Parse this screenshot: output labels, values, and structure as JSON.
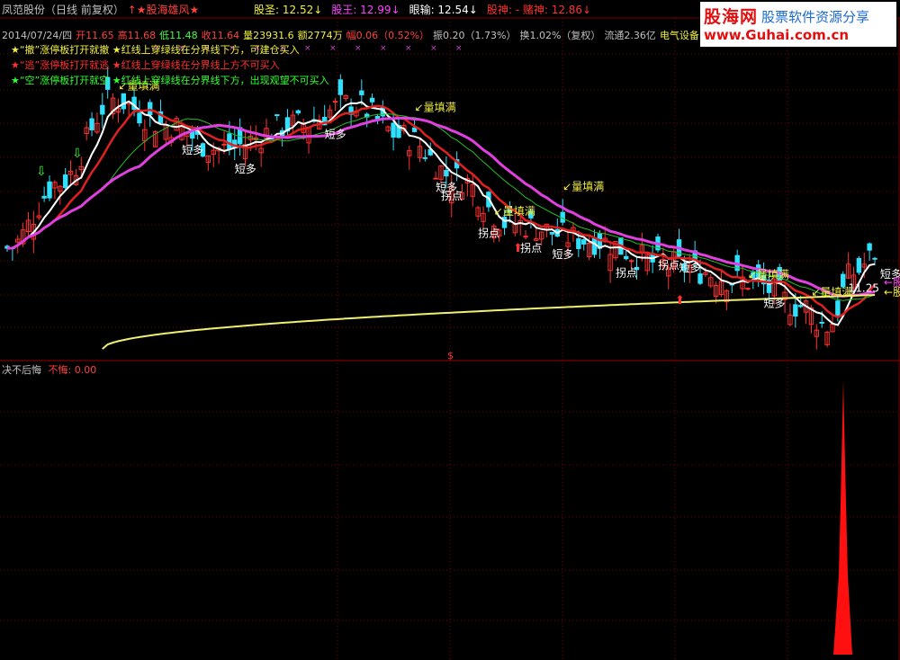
{
  "header": {
    "stock": "凤范股份（日线 前复权）",
    "indicator": "↑★股海雄风★",
    "items": [
      {
        "label": "股圣: 12.52",
        "arrow": "↓",
        "color": "#f0f040"
      },
      {
        "label": "股王: 12.99",
        "arrow": "↓",
        "color": "#ff40ff"
      },
      {
        "label": "眼输: 12.54",
        "arrow": "↓",
        "color": "#ffffff"
      },
      {
        "label": "股神: - 赌神: 12.86",
        "arrow": "↓",
        "color": "#ff3030"
      }
    ]
  },
  "logo": {
    "brand": "股海网",
    "tagline": "股票软件资源分享",
    "url": "www.Guhai.com.cn"
  },
  "info_line": [
    {
      "text": "2014/07/24/四",
      "color": "#c0c0c0"
    },
    {
      "text": "开11.65",
      "color": "#ff4040"
    },
    {
      "text": "高11.68",
      "color": "#ff4040"
    },
    {
      "text": "低11.48",
      "color": "#40ff40"
    },
    {
      "text": "收11.64",
      "color": "#ff4040"
    },
    {
      "text": "量23931.6",
      "color": "#f0f040"
    },
    {
      "text": "额2774万",
      "color": "#f0f040"
    },
    {
      "text": "幅0.06（0.52%）",
      "color": "#ff4040"
    },
    {
      "text": "振0.20（1.73%）",
      "color": "#c0c0c0"
    },
    {
      "text": "换1.02%（复权）",
      "color": "#c0c0c0"
    },
    {
      "text": "流通2.36亿",
      "color": "#c0c0c0"
    },
    {
      "text": "电气设备",
      "color": "#f0f040"
    }
  ],
  "legend": [
    {
      "star_color": "#f0f040",
      "text": "★“撤”涨停板打开就撤   ★红线上穿绿线在分界线下方，可建仓买入",
      "color": "#f0f040"
    },
    {
      "star_color": "#ff3030",
      "text": "★“逃”涨停板打开就逃   ★红线上穿绿线在分界线上方不可买入",
      "color": "#ff3030"
    },
    {
      "star_color": "#30ff30",
      "text": "★“空”涨停板打开就空   ★红线上穿绿线在分界线下方，出现观望不可买入",
      "color": "#30ff30"
    }
  ],
  "sub_panel": {
    "title": "决不后悔",
    "value_label": "不悔: 0.00"
  },
  "colors": {
    "up": "#ff3030",
    "down": "#30e0ff",
    "ma_white": "#ffffff",
    "ma_red": "#e02020",
    "ma_green": "#20c020",
    "ma_magenta": "#e040e0",
    "ma_yellow": "#f0f070",
    "grid": "#7a0000"
  },
  "chart_data": {
    "type": "candlestick",
    "date": "2014/07/24",
    "last_bar": {
      "open": 11.65,
      "high": 11.68,
      "low": 11.48,
      "close": 11.64
    },
    "annotations": [
      {
        "text": "↙量填满",
        "bar": 21
      },
      {
        "text": "短多",
        "bar": 33
      },
      {
        "text": "短多",
        "bar": 43
      },
      {
        "text": "短多",
        "bar": 60
      },
      {
        "text": "↙量填满",
        "bar": 77
      },
      {
        "text": "短多",
        "bar": 81
      },
      {
        "text": "拐点",
        "bar": 82
      },
      {
        "text": "↙量填满",
        "bar": 92
      },
      {
        "text": "拐点",
        "bar": 89
      },
      {
        "text": "拐点",
        "bar": 97
      },
      {
        "text": "↙量填满",
        "bar": 105
      },
      {
        "text": "短多",
        "bar": 103
      },
      {
        "text": "拐点",
        "bar": 115
      },
      {
        "text": "短多",
        "bar": 127
      },
      {
        "text": "拐点",
        "bar": 123
      },
      {
        "text": "↙量填满",
        "bar": 140
      },
      {
        "text": "短多",
        "bar": 143
      },
      {
        "text": "↙量填满",
        "bar": 152
      },
      {
        "text": "短多",
        "bar": 165
      },
      {
        "text": "11.25",
        "bar": 159
      }
    ],
    "price_labels": [
      "股圣",
      "股王"
    ],
    "sub_panel_series": {
      "name": "不悔",
      "last_value": 0.0
    }
  }
}
